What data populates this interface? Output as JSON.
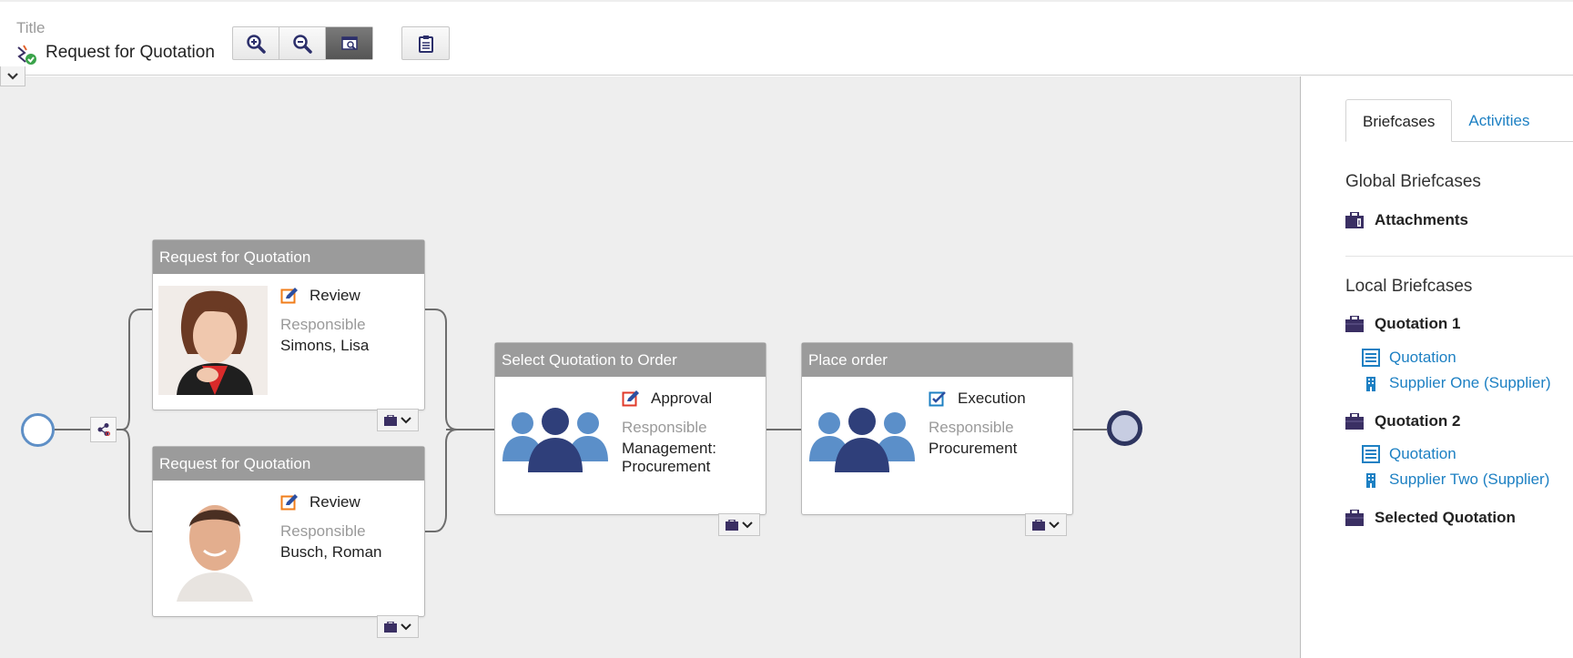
{
  "header": {
    "title_label": "Title",
    "title": "Request for Quotation",
    "toolbar": {
      "zoom_in": "zoom-in-icon",
      "zoom_out": "zoom-out-icon",
      "fit_view": "fit-view-icon",
      "clipboard": "clipboard-icon"
    }
  },
  "process": {
    "nodes": [
      {
        "title": "Request for Quotation",
        "task": "Review",
        "responsible_label": "Responsible",
        "responsible": "Simons, Lisa"
      },
      {
        "title": "Request for Quotation",
        "task": "Review",
        "responsible_label": "Responsible",
        "responsible": "Busch, Roman"
      },
      {
        "title": "Select Quotation to Order",
        "task": "Approval",
        "responsible_label": "Responsible",
        "responsible_line1": "Management:",
        "responsible_line2": "Procurement"
      },
      {
        "title": "Place order",
        "task": "Execution",
        "responsible_label": "Responsible",
        "responsible": "Procurement"
      }
    ]
  },
  "side_panel": {
    "tabs": [
      {
        "label": "Briefcases",
        "active": true
      },
      {
        "label": "Activities",
        "active": false
      }
    ],
    "global_title": "Global Briefcases",
    "global_items": [
      {
        "label": "Attachments"
      }
    ],
    "local_title": "Local Briefcases",
    "local_briefcases": [
      {
        "label": "Quotation 1",
        "items": [
          {
            "label": "Quotation"
          },
          {
            "label": "Supplier One (Supplier)"
          }
        ]
      },
      {
        "label": "Quotation 2",
        "items": [
          {
            "label": "Quotation"
          },
          {
            "label": "Supplier Two (Supplier)"
          }
        ]
      },
      {
        "label": "Selected Quotation",
        "items": []
      }
    ]
  },
  "colors": {
    "accent_link": "#1d80c3",
    "node_header": "#9b9b9b",
    "canvas_bg": "#eeeeee",
    "briefcase_icon": "#3a2f63",
    "group_icon_dark": "#2f3f7a",
    "group_icon_light": "#5b8fc9"
  }
}
